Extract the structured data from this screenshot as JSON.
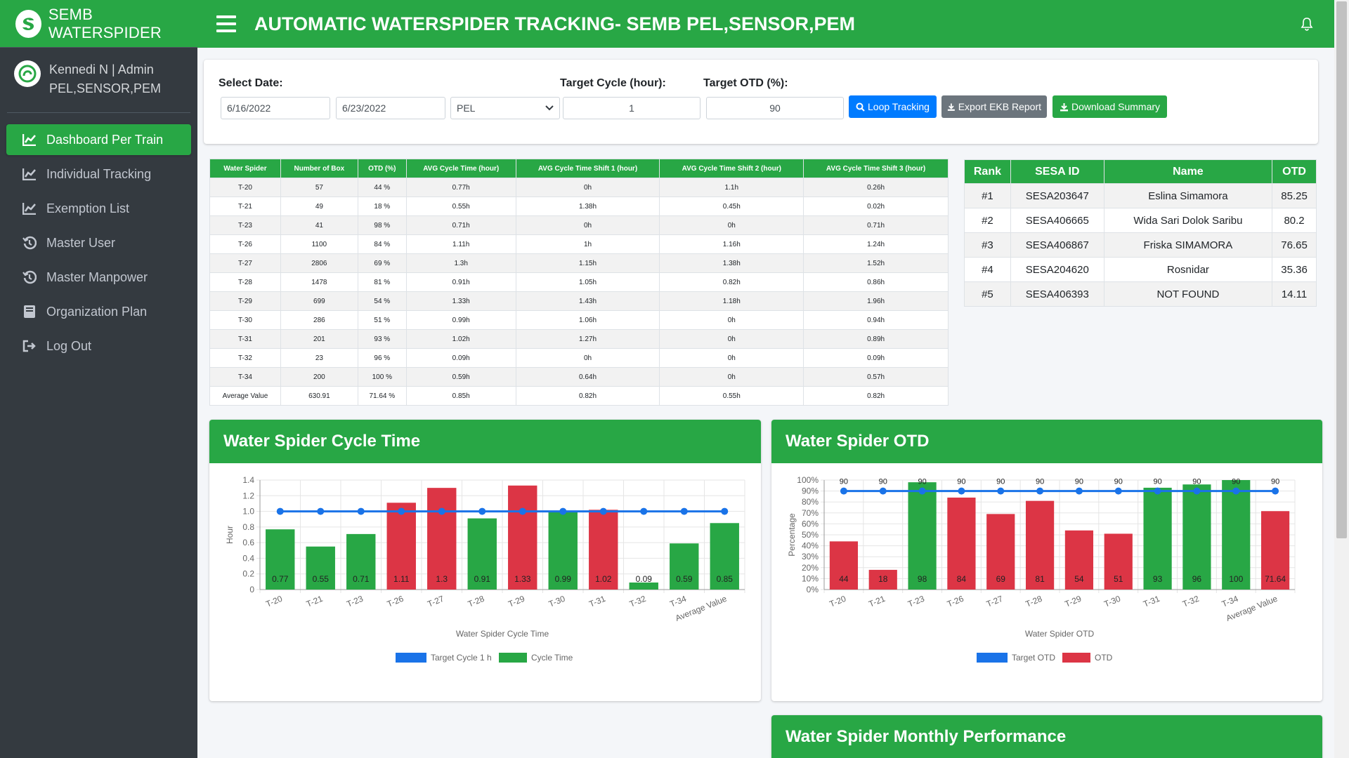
{
  "brand": {
    "name": "SEMB WATERSPIDER"
  },
  "user": {
    "line1": "Kennedi N | Admin",
    "line2": "PEL,SENSOR,PEM"
  },
  "nav": [
    {
      "label": "Dashboard Per Train",
      "icon": "chart-line-icon",
      "active": true
    },
    {
      "label": "Individual Tracking",
      "icon": "chart-line-icon"
    },
    {
      "label": "Exemption List",
      "icon": "chart-line-icon"
    },
    {
      "label": "Master User",
      "icon": "history-icon"
    },
    {
      "label": "Master Manpower",
      "icon": "history-icon"
    },
    {
      "label": "Organization Plan",
      "icon": "book-icon"
    },
    {
      "label": "Log Out",
      "icon": "logout-icon"
    }
  ],
  "header": {
    "title": "AUTOMATIC WATERSPIDER TRACKING- SEMB PEL,SENSOR,PEM"
  },
  "filters": {
    "select_date_label": "Select Date:",
    "start_date": "6/16/2022",
    "end_date": "6/23/2022",
    "area": "PEL",
    "target_cycle_label": "Target Cycle (hour):",
    "target_cycle": "1",
    "target_otd_label": "Target OTD (%):",
    "target_otd": "90",
    "loop_tracking": "Loop Tracking",
    "export_ekb": "Export EKB Report",
    "download_summary": "Download Summary"
  },
  "summary_table": {
    "headers": [
      "Water Spider",
      "Number of Box",
      "OTD (%)",
      "AVG Cycle Time (hour)",
      "AVG Cycle Time Shift 1 (hour)",
      "AVG Cycle Time Shift 2 (hour)",
      "AVG Cycle Time Shift 3 (hour)"
    ],
    "rows": [
      [
        "T-20",
        "57",
        "44 %",
        "0.77h",
        "0h",
        "1.1h",
        "0.26h"
      ],
      [
        "T-21",
        "49",
        "18 %",
        "0.55h",
        "1.38h",
        "0.45h",
        "0.02h"
      ],
      [
        "T-23",
        "41",
        "98 %",
        "0.71h",
        "0h",
        "0h",
        "0.71h"
      ],
      [
        "T-26",
        "1100",
        "84 %",
        "1.11h",
        "1h",
        "1.16h",
        "1.24h"
      ],
      [
        "T-27",
        "2806",
        "69 %",
        "1.3h",
        "1.15h",
        "1.38h",
        "1.52h"
      ],
      [
        "T-28",
        "1478",
        "81 %",
        "0.91h",
        "1.05h",
        "0.82h",
        "0.86h"
      ],
      [
        "T-29",
        "699",
        "54 %",
        "1.33h",
        "1.43h",
        "1.18h",
        "1.96h"
      ],
      [
        "T-30",
        "286",
        "51 %",
        "0.99h",
        "1.06h",
        "0h",
        "0.94h"
      ],
      [
        "T-31",
        "201",
        "93 %",
        "1.02h",
        "1.27h",
        "0h",
        "0.89h"
      ],
      [
        "T-32",
        "23",
        "96 %",
        "0.09h",
        "0h",
        "0h",
        "0.09h"
      ],
      [
        "T-34",
        "200",
        "100 %",
        "0.59h",
        "0.64h",
        "0h",
        "0.57h"
      ],
      [
        "Average Value",
        "630.91",
        "71.64 %",
        "0.85h",
        "0.82h",
        "0.55h",
        "0.82h"
      ]
    ]
  },
  "rank_table": {
    "headers": [
      "Rank",
      "SESA ID",
      "Name",
      "OTD"
    ],
    "rows": [
      [
        "#1",
        "SESA203647",
        "Eslina Simamora",
        "85.25"
      ],
      [
        "#2",
        "SESA406665",
        "Wida Sari Dolok Saribu",
        "80.2"
      ],
      [
        "#3",
        "SESA406867",
        "Friska SIMAMORA",
        "76.65"
      ],
      [
        "#4",
        "SESA204620",
        "Rosnidar",
        "35.36"
      ],
      [
        "#5",
        "SESA406393",
        "NOT FOUND",
        "14.11"
      ]
    ]
  },
  "cards": {
    "cycle_title": "Water Spider Cycle Time",
    "otd_title": "Water Spider OTD",
    "monthly_title": "Water Spider Monthly Performance"
  },
  "colors": {
    "green": "#28a745",
    "red": "#dc3545",
    "blue": "#1a73e8",
    "sidebar": "#343a40"
  },
  "chart_data": [
    {
      "type": "bar",
      "categories": [
        "T-20",
        "T-21",
        "T-23",
        "T-26",
        "T-27",
        "T-28",
        "T-29",
        "T-30",
        "T-31",
        "T-32",
        "T-34",
        "Average Value"
      ],
      "series": [
        {
          "name": "Cycle Time",
          "values": [
            0.77,
            0.55,
            0.71,
            1.11,
            1.3,
            0.91,
            1.33,
            0.99,
            1.02,
            0.09,
            0.59,
            0.85
          ]
        },
        {
          "name": "Target Cycle 1 h",
          "type": "line",
          "values": [
            1,
            1,
            1,
            1,
            1,
            1,
            1,
            1,
            1,
            1,
            1,
            1
          ]
        }
      ],
      "xlabel": "Water Spider Cycle Time",
      "ylabel": "Hour",
      "ylim": [
        0,
        1.4
      ],
      "yticks": [
        "0",
        "0.2",
        "0.4",
        "0.6",
        "0.8",
        "1.0",
        "1.2",
        "1.4"
      ],
      "grid": true,
      "legend": "bottom"
    },
    {
      "type": "bar",
      "categories": [
        "T-20",
        "T-21",
        "T-23",
        "T-26",
        "T-27",
        "T-28",
        "T-29",
        "T-30",
        "T-31",
        "T-32",
        "T-34",
        "Average Value"
      ],
      "series": [
        {
          "name": "OTD",
          "values": [
            44,
            18,
            98,
            84,
            69,
            81,
            54,
            51,
            93,
            96,
            100,
            71.64
          ]
        },
        {
          "name": "Target OTD",
          "type": "line",
          "values": [
            90,
            90,
            90,
            90,
            90,
            90,
            90,
            90,
            90,
            90,
            90,
            90
          ]
        }
      ],
      "xlabel": "Water Spider OTD",
      "ylabel": "Percentage",
      "ylim": [
        0,
        100
      ],
      "yticks": [
        "0%",
        "10%",
        "20%",
        "30%",
        "40%",
        "50%",
        "60%",
        "70%",
        "80%",
        "90%",
        "100%"
      ],
      "grid": true,
      "legend": "bottom"
    }
  ]
}
